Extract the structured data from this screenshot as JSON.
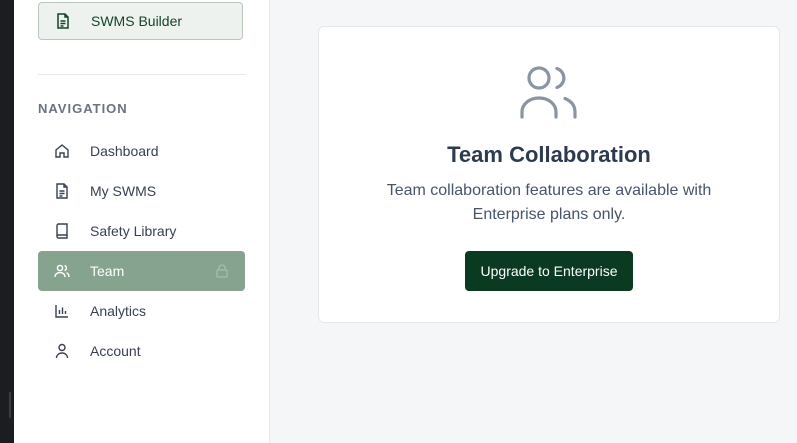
{
  "sidebar": {
    "builder_label": "SWMS Builder",
    "nav_heading": "NAVIGATION",
    "items": [
      {
        "label": "Dashboard",
        "icon": "home-icon"
      },
      {
        "label": "My SWMS",
        "icon": "document-icon"
      },
      {
        "label": "Safety Library",
        "icon": "book-icon"
      },
      {
        "label": "Team",
        "icon": "users-icon",
        "active": true,
        "locked": true
      },
      {
        "label": "Analytics",
        "icon": "bar-chart-icon"
      },
      {
        "label": "Account",
        "icon": "user-icon"
      }
    ]
  },
  "main": {
    "card": {
      "icon": "users-icon",
      "title": "Team Collaboration",
      "description": "Team collaboration features are available with Enterprise plans only.",
      "button_label": "Upgrade to Enterprise"
    }
  },
  "colors": {
    "accent_dark": "#0b3a22",
    "active_nav": "#86a390",
    "title": "#2d3b4e"
  }
}
